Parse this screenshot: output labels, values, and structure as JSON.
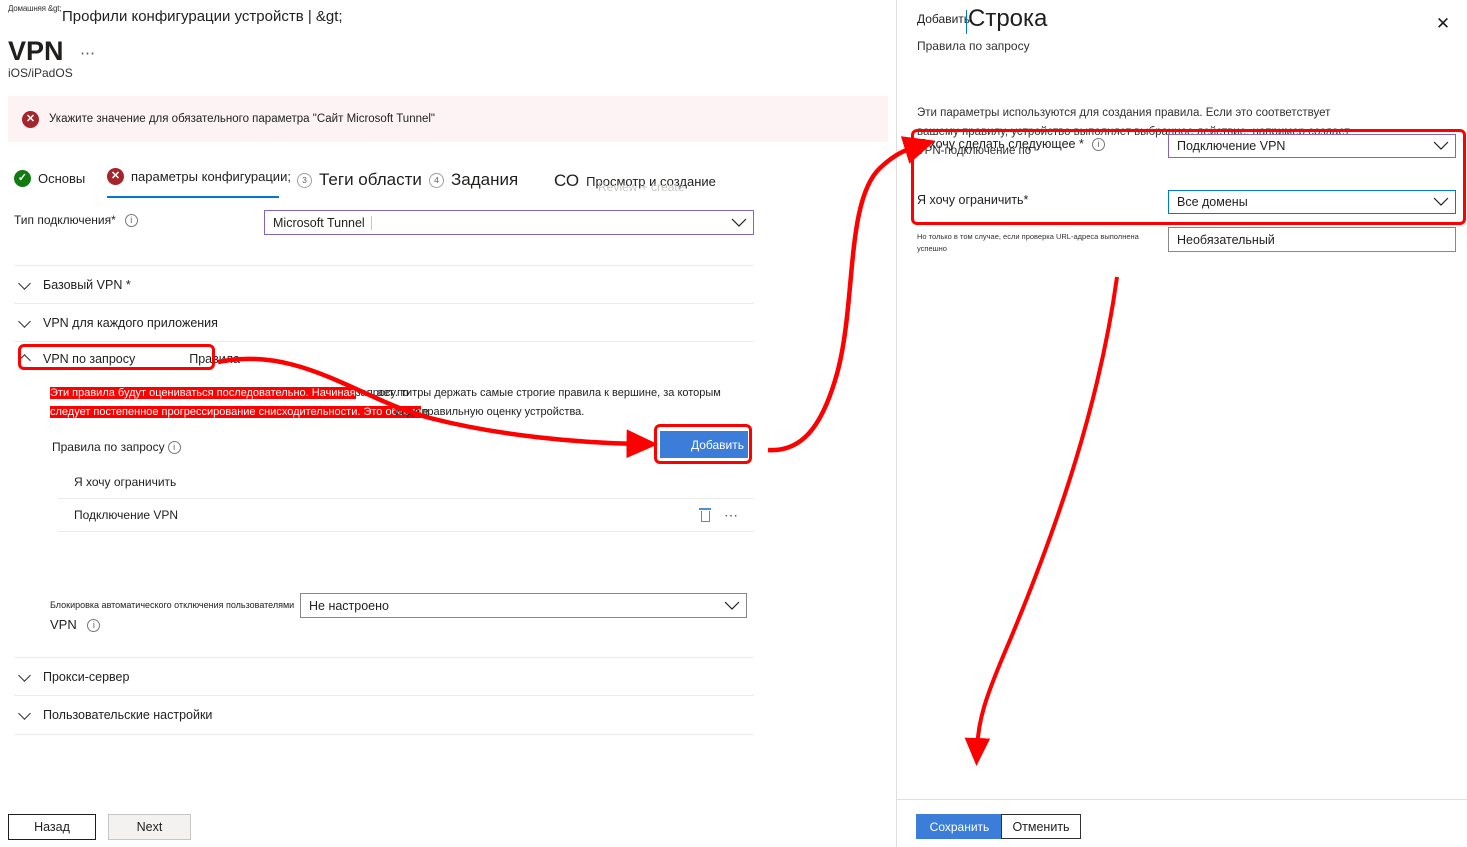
{
  "breadcrumb": {
    "home": "Домашняя &gt;",
    "path": "Профили конфигурации устройств | &gt;"
  },
  "header": {
    "title": "VPN",
    "ellipsis": "⋯",
    "platform": "iOS/iPadOS"
  },
  "error_banner": {
    "icon": "error-x-icon",
    "message": "Укажите значение для обязательного параметра \"Сайт Microsoft Tunnel\""
  },
  "wizard_tabs": [
    {
      "num": "1",
      "label": "Основы",
      "state": "valid",
      "icon": "check-circle-icon"
    },
    {
      "num": "2",
      "label": "параметры конфигурации;",
      "state": "error",
      "icon": "error-x-icon",
      "selected": true
    },
    {
      "num": "3",
      "label": "Теги области",
      "state": "pending"
    },
    {
      "num": "4",
      "label": "Задания",
      "state": "pending"
    },
    {
      "num": "5",
      "label": "Просмотр и создание",
      "prefix": "СО",
      "ghost": "Review + create",
      "state": "pending"
    }
  ],
  "connection_type": {
    "label": "Тип подключения*",
    "info_icon": "info-icon",
    "value": "Microsoft Tunnel"
  },
  "sections": [
    {
      "id": "base-vpn",
      "title": "Базовый VPN *",
      "expanded": false
    },
    {
      "id": "per-app-vpn",
      "title": "VPN для каждого приложения",
      "expanded": false
    },
    {
      "id": "on-demand-vpn",
      "title": "VPN по запросу",
      "extra": "Правила",
      "expanded": true
    },
    {
      "id": "proxy",
      "title": "Прокси-сервер",
      "expanded": false
    },
    {
      "id": "custom-settings",
      "title": "Пользовательские настройки",
      "expanded": false
    }
  ],
  "on_demand": {
    "note_highlight_1": "Эти правила будут оцениваться последовательно. Начиная",
    "note_overlay_1": "ает по",
    "note_tail_1": "запросу. титры держать самые строгие правила к вершине, за которым",
    "note_highlight_2": "следует постепенное прогрессирование снисходительности. Это обеспе",
    "note_overlay_2": "инде е",
    "note_tail_2": "правильную оценку устройства.",
    "rules_label": "Правила по запросу",
    "rules_info_icon": "info-icon",
    "add_button": "Добавить",
    "rows": [
      {
        "text": "Я хочу ограничить",
        "actions": false
      },
      {
        "text": "Подключение VPN",
        "actions": true,
        "delete_icon": "trash-icon",
        "more_icon": "ellipsis-icon"
      }
    ]
  },
  "block_disconnect": {
    "label_line1": "Блокировка автоматического отключения пользователями",
    "label_line2": "VPN",
    "info_icon": "info-icon",
    "value": "Не настроено"
  },
  "footer": {
    "back": "Назад",
    "next": "Next"
  },
  "panel": {
    "add_word": "Добавить",
    "title": "Строка",
    "subtitle": "Правила по запросу",
    "close_icon": "close-icon",
    "description": "Эти параметры используются для создания правила. Если это соответствует вашему правилу, устройство выполняет выбранное действие, например создает VPN-подключение по",
    "fields": [
      {
        "id": "i-want-to-do",
        "label": "Я хочу сделать следующее *",
        "info_icon": "info-icon",
        "value": "Подключение VPN",
        "border": "purple"
      },
      {
        "id": "i-want-to-restrict",
        "label": "Я хочу ограничить*",
        "value": "Все домены",
        "border": "blue"
      },
      {
        "id": "url-probe",
        "label": "Но только в том случае, если проверка URL-адреса выполнена успешно",
        "value": "Необязательный",
        "border": "default"
      }
    ],
    "save": "Сохранить",
    "cancel": "Отменить"
  },
  "colors": {
    "annotation_red": "#ff0000",
    "primary_blue": "#3b7dd8",
    "accent_blue": "#0078d4",
    "error_red": "#a4262c",
    "success_green": "#107c10",
    "purple_border": "#8764b8",
    "banner_bg": "#fdf3f4"
  }
}
